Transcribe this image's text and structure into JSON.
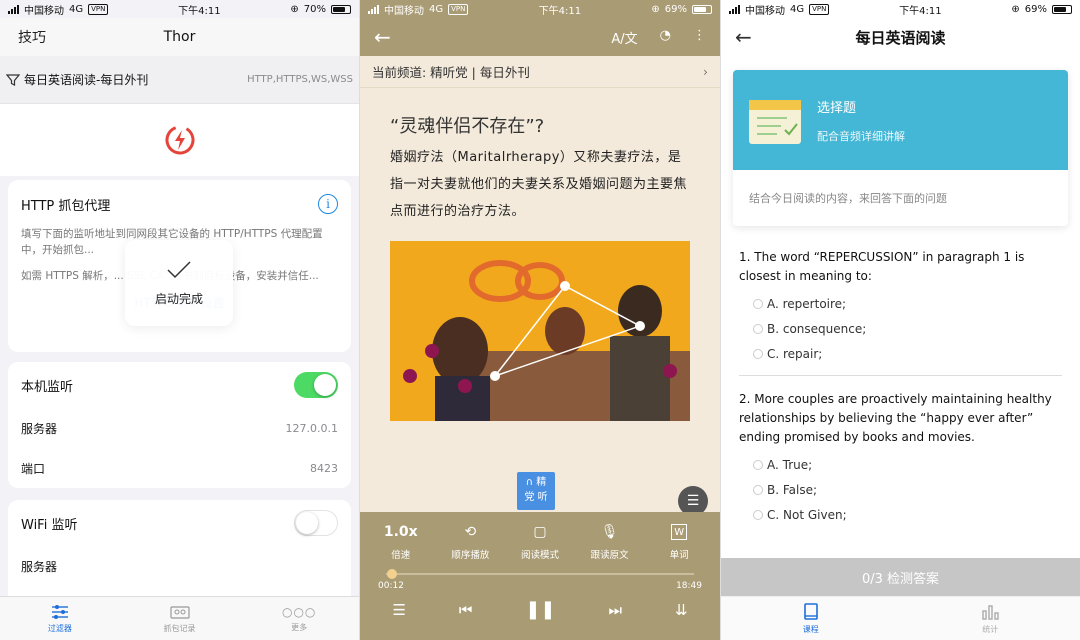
{
  "status_bars": [
    {
      "carrier": "中国移动",
      "network": "4G",
      "vpn": "VPN",
      "time": "下午4:11",
      "battery": "70%"
    },
    {
      "carrier": "中国移动",
      "network": "4G",
      "vpn": "VPN",
      "time": "下午4:11",
      "battery": "69%"
    },
    {
      "carrier": "中国移动",
      "network": "4G",
      "vpn": "VPN",
      "time": "下午4:11",
      "battery": "69%"
    }
  ],
  "thor": {
    "nav_left": "技巧",
    "title": "Thor",
    "filter_name": "每日英语阅读-每日外刊",
    "protocols": "HTTP,HTTPS,WS,WSS",
    "http_card": {
      "title": "HTTP 抓包代理",
      "desc1": "填写下面的监听地址到同网段其它设备的 HTTP/HTTPS 代理配置中，开始抓包...",
      "desc2": "如需 HTTPS 解析，... SSL CA\" 证书到目标设备，安装并信任...",
      "link": "HTTPS 解析设置"
    },
    "toast": "启动完成",
    "local": {
      "label": "本机监听",
      "server_label": "服务器",
      "server": "127.0.0.1",
      "port_label": "端口",
      "port": "8423"
    },
    "wifi": {
      "label": "WiFi 监听",
      "server_label": "服务器"
    },
    "tabs": [
      "过滤器",
      "抓包记录",
      "更多"
    ]
  },
  "reader": {
    "channel": "当前频道: 精听党 | 每日外刊",
    "title": "“灵魂伴侣不存在”?",
    "body": "婚姻疗法（Maritalrherapy）又称夫妻疗法，是指一对夫妻就他们的夫妻关系及婚姻问题为主要焦点而进行的治疗方法。",
    "badge_line1": "∩ 精",
    "badge_line2": "党 听",
    "controls": [
      {
        "icon": "1.0x",
        "label": "倍速"
      },
      {
        "icon": "⟲",
        "label": "顺序播放"
      },
      {
        "icon": "▢",
        "label": "阅读模式"
      },
      {
        "icon": "🎙",
        "label": "跟读原文"
      },
      {
        "icon": "W",
        "label": "单词"
      }
    ],
    "elapsed": "00:12",
    "duration": "18:49",
    "progress": 0.01
  },
  "quiz": {
    "title": "每日英语阅读",
    "card_title": "选择题",
    "card_sub": "配合音频详细讲解",
    "card_note": "结合今日阅读的内容，来回答下面的问题",
    "questions": [
      {
        "stem": "1. The word “REPERCUSSION” in paragraph 1 is closest in meaning to:",
        "options": [
          "A. repertoire;",
          "B. consequence;",
          "C. repair;"
        ]
      },
      {
        "stem": "2. More couples are proactively maintaining healthy relationships by believing the “happy ever after” ending promised by books and movies.",
        "options": [
          "A. True;",
          "B. False;",
          "C. Not Given;"
        ]
      }
    ],
    "check_button": "0/3 检测答案",
    "tabs": [
      "课程",
      "统计"
    ]
  }
}
